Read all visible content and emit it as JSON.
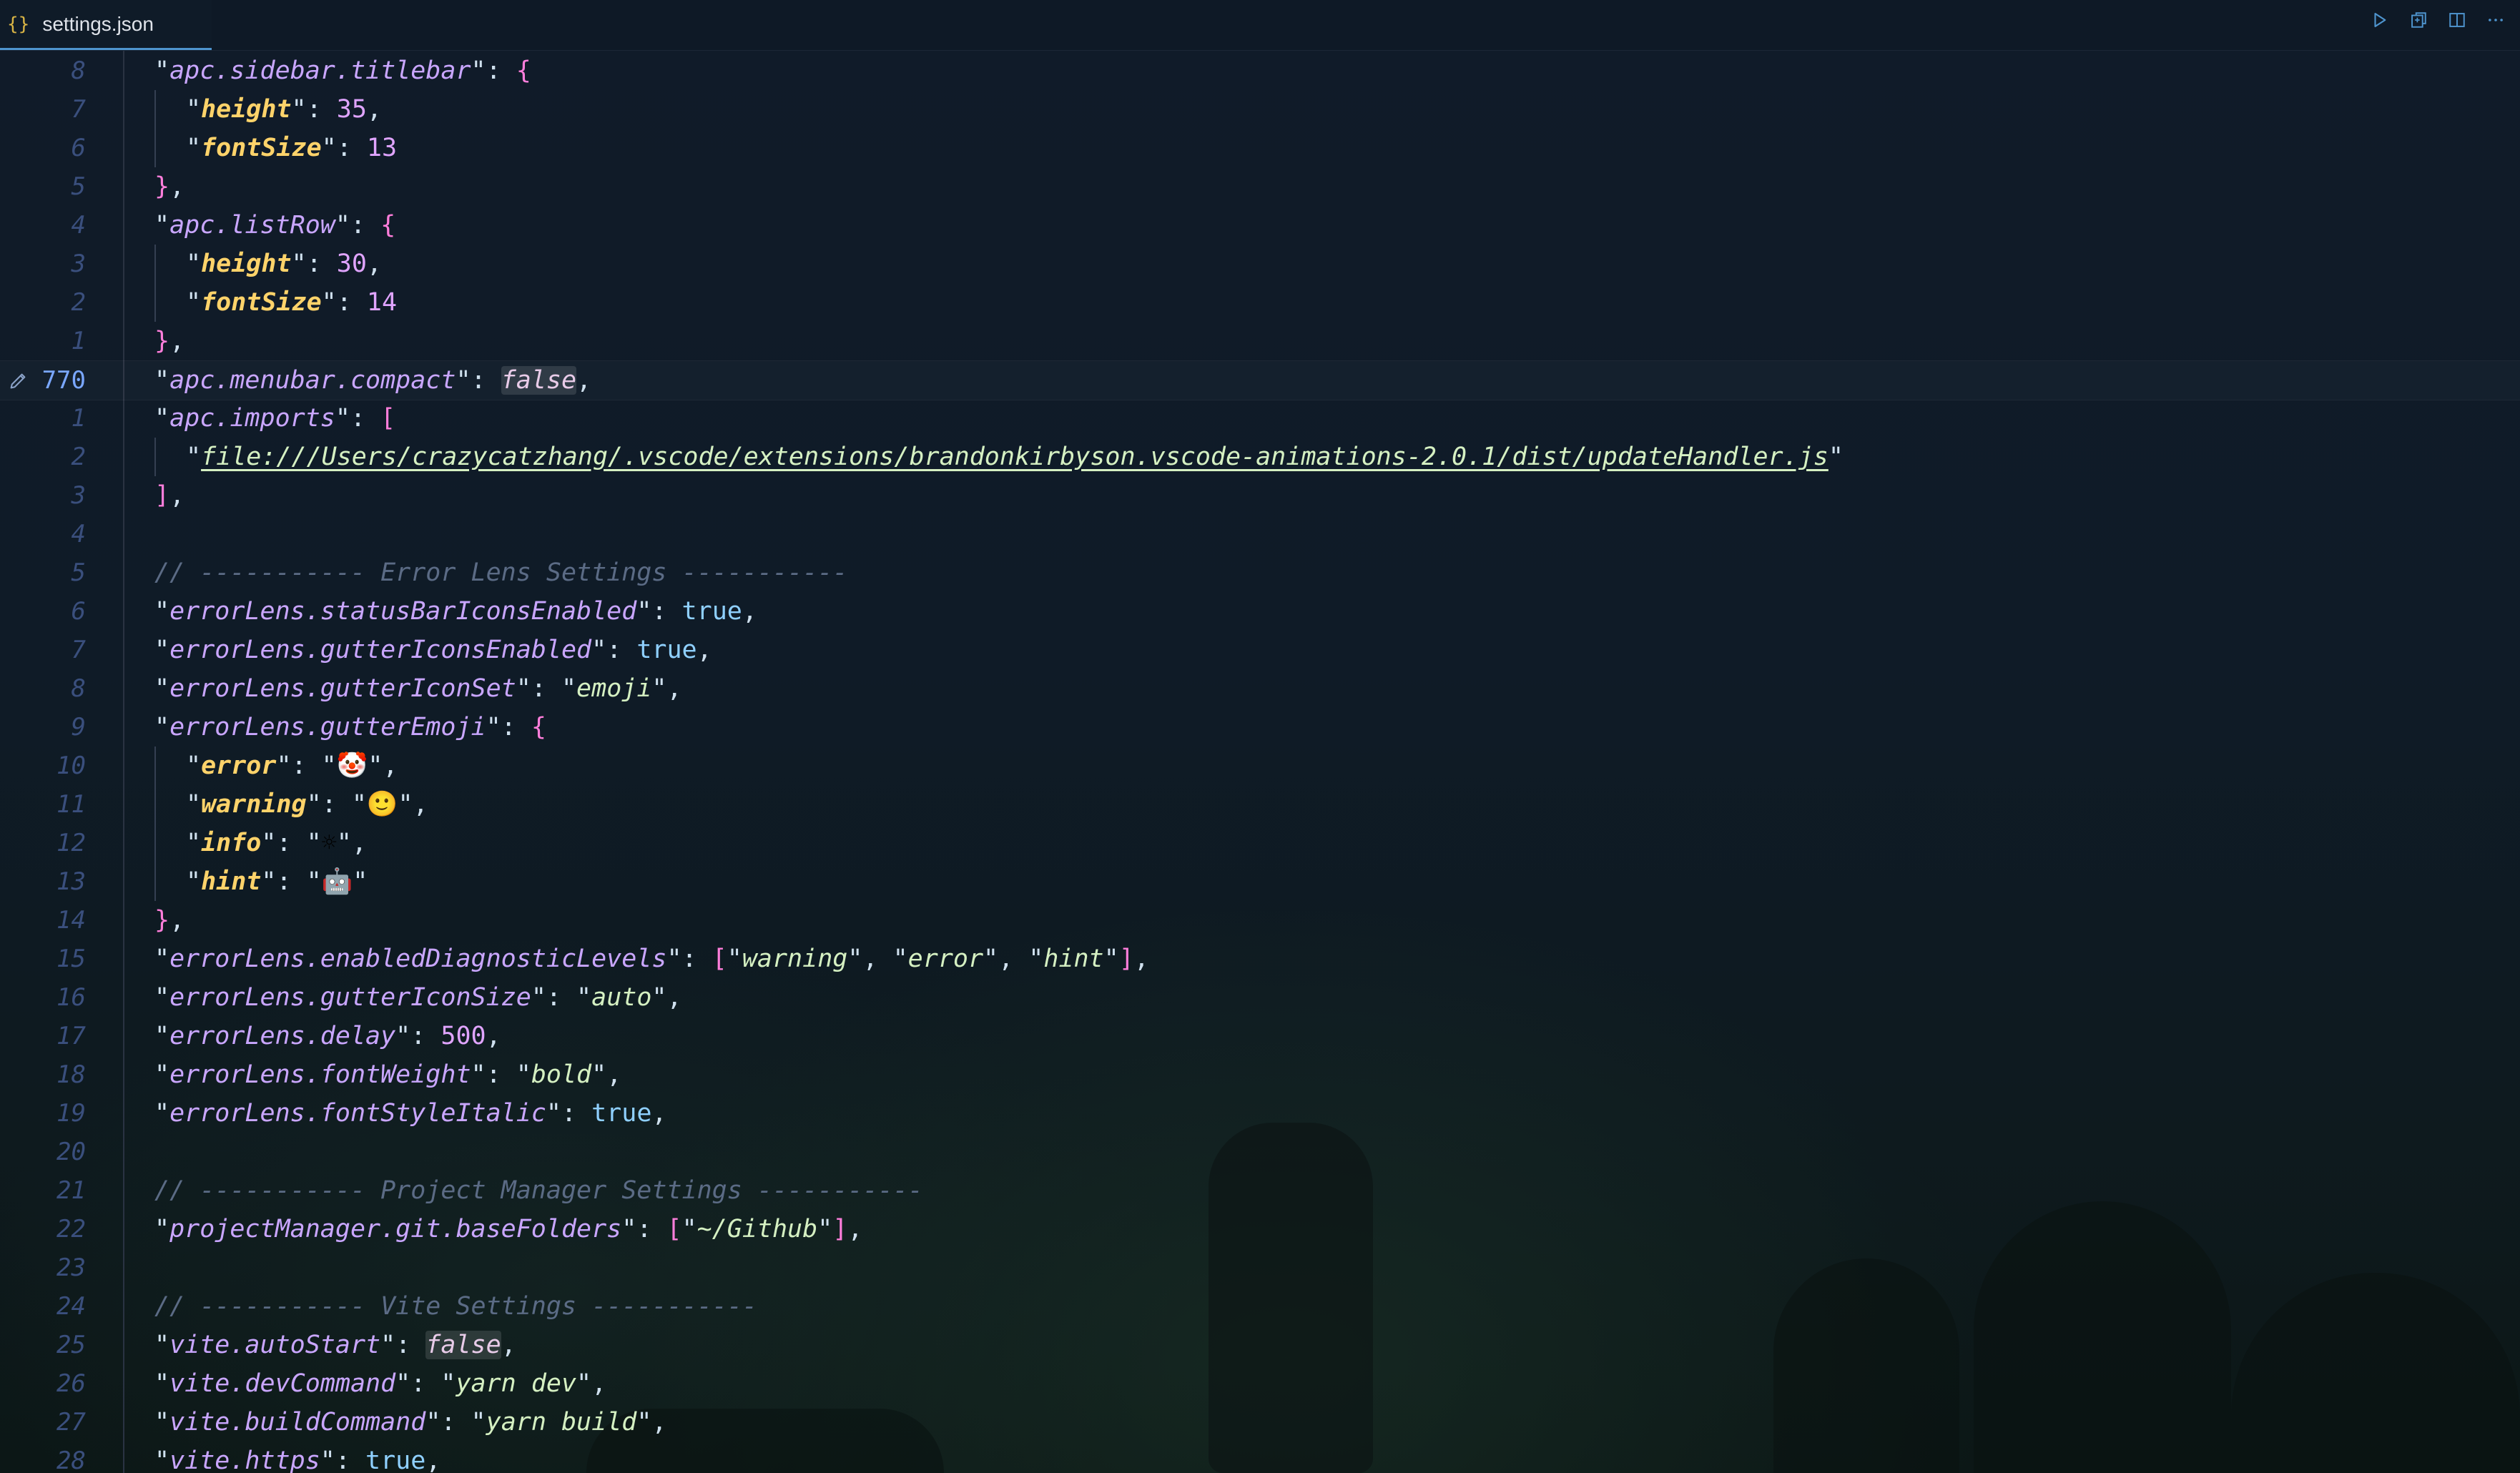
{
  "tab": {
    "icon": "{}",
    "label": "settings.json"
  },
  "actions": [
    {
      "name": "run-icon"
    },
    {
      "name": "open-changes-icon"
    },
    {
      "name": "split-editor-icon"
    },
    {
      "name": "more-actions-icon"
    }
  ],
  "editor": {
    "current_line": 770,
    "lines": [
      {
        "num": "8",
        "indent": 0,
        "tokens": [
          [
            "q",
            "\""
          ],
          [
            "k",
            "apc.sidebar.titlebar"
          ],
          [
            "q",
            "\""
          ],
          [
            "p",
            ": "
          ],
          [
            "b",
            "{"
          ]
        ]
      },
      {
        "num": "7",
        "indent": 1,
        "tokens": [
          [
            "q",
            "\""
          ],
          [
            "kk",
            "height"
          ],
          [
            "q",
            "\""
          ],
          [
            "p",
            ": "
          ],
          [
            "n",
            "35"
          ],
          [
            "p",
            ","
          ]
        ]
      },
      {
        "num": "6",
        "indent": 1,
        "tokens": [
          [
            "q",
            "\""
          ],
          [
            "kk",
            "fontSize"
          ],
          [
            "q",
            "\""
          ],
          [
            "p",
            ": "
          ],
          [
            "n",
            "13"
          ]
        ]
      },
      {
        "num": "5",
        "indent": 0,
        "tokens": [
          [
            "b",
            "}"
          ],
          [
            "p",
            ","
          ]
        ]
      },
      {
        "num": "4",
        "indent": 0,
        "tokens": [
          [
            "q",
            "\""
          ],
          [
            "k",
            "apc.listRow"
          ],
          [
            "q",
            "\""
          ],
          [
            "p",
            ": "
          ],
          [
            "b",
            "{"
          ]
        ]
      },
      {
        "num": "3",
        "indent": 1,
        "tokens": [
          [
            "q",
            "\""
          ],
          [
            "kk",
            "height"
          ],
          [
            "q",
            "\""
          ],
          [
            "p",
            ": "
          ],
          [
            "n",
            "30"
          ],
          [
            "p",
            ","
          ]
        ]
      },
      {
        "num": "2",
        "indent": 1,
        "tokens": [
          [
            "q",
            "\""
          ],
          [
            "kk",
            "fontSize"
          ],
          [
            "q",
            "\""
          ],
          [
            "p",
            ": "
          ],
          [
            "n",
            "14"
          ]
        ]
      },
      {
        "num": "1",
        "indent": 0,
        "tokens": [
          [
            "b",
            "}"
          ],
          [
            "p",
            ","
          ]
        ]
      },
      {
        "num": "770",
        "indent": 0,
        "current": true,
        "tokens": [
          [
            "q",
            "\""
          ],
          [
            "k",
            "apc.menubar.compact"
          ],
          [
            "q",
            "\""
          ],
          [
            "p",
            ": "
          ],
          [
            "f",
            "false"
          ],
          [
            "p",
            ","
          ]
        ]
      },
      {
        "num": "1",
        "indent": 0,
        "tokens": [
          [
            "q",
            "\""
          ],
          [
            "k",
            "apc.imports"
          ],
          [
            "q",
            "\""
          ],
          [
            "p",
            ": "
          ],
          [
            "b",
            "["
          ]
        ]
      },
      {
        "num": "2",
        "indent": 1,
        "tokens": [
          [
            "q",
            "\""
          ],
          [
            "u",
            "file:///Users/crazycatzhang/.vscode/extensions/brandonkirbyson.vscode-animations-2.0.1/dist/updateHandler.js"
          ],
          [
            "q",
            "\""
          ]
        ]
      },
      {
        "num": "3",
        "indent": 0,
        "tokens": [
          [
            "b",
            "]"
          ],
          [
            "p",
            ","
          ]
        ]
      },
      {
        "num": "4",
        "indent": 0,
        "tokens": []
      },
      {
        "num": "5",
        "indent": 0,
        "tokens": [
          [
            "c",
            "// ----------- Error Lens Settings -----------"
          ]
        ]
      },
      {
        "num": "6",
        "indent": 0,
        "tokens": [
          [
            "q",
            "\""
          ],
          [
            "k",
            "errorLens.statusBarIconsEnabled"
          ],
          [
            "q",
            "\""
          ],
          [
            "p",
            ": "
          ],
          [
            "t",
            "true"
          ],
          [
            "p",
            ","
          ]
        ]
      },
      {
        "num": "7",
        "indent": 0,
        "tokens": [
          [
            "q",
            "\""
          ],
          [
            "k",
            "errorLens.gutterIconsEnabled"
          ],
          [
            "q",
            "\""
          ],
          [
            "p",
            ": "
          ],
          [
            "t",
            "true"
          ],
          [
            "p",
            ","
          ]
        ]
      },
      {
        "num": "8",
        "indent": 0,
        "tokens": [
          [
            "q",
            "\""
          ],
          [
            "k",
            "errorLens.gutterIconSet"
          ],
          [
            "q",
            "\""
          ],
          [
            "p",
            ": "
          ],
          [
            "q",
            "\""
          ],
          [
            "s",
            "emoji"
          ],
          [
            "q",
            "\""
          ],
          [
            "p",
            ","
          ]
        ]
      },
      {
        "num": "9",
        "indent": 0,
        "tokens": [
          [
            "q",
            "\""
          ],
          [
            "k",
            "errorLens.gutterEmoji"
          ],
          [
            "q",
            "\""
          ],
          [
            "p",
            ": "
          ],
          [
            "b",
            "{"
          ]
        ]
      },
      {
        "num": "10",
        "indent": 1,
        "tokens": [
          [
            "q",
            "\""
          ],
          [
            "kk",
            "error"
          ],
          [
            "q",
            "\""
          ],
          [
            "p",
            ": "
          ],
          [
            "q",
            "\""
          ],
          [
            "emo",
            "🤡"
          ],
          [
            "q",
            "\""
          ],
          [
            "p",
            ","
          ]
        ]
      },
      {
        "num": "11",
        "indent": 1,
        "tokens": [
          [
            "q",
            "\""
          ],
          [
            "kk",
            "warning"
          ],
          [
            "q",
            "\""
          ],
          [
            "p",
            ": "
          ],
          [
            "q",
            "\""
          ],
          [
            "emo",
            "🙂"
          ],
          [
            "q",
            "\""
          ],
          [
            "p",
            ","
          ]
        ]
      },
      {
        "num": "12",
        "indent": 1,
        "tokens": [
          [
            "q",
            "\""
          ],
          [
            "kk",
            "info"
          ],
          [
            "q",
            "\""
          ],
          [
            "p",
            ": "
          ],
          [
            "q",
            "\""
          ],
          [
            "emo",
            "☼"
          ],
          [
            "q",
            "\""
          ],
          [
            "p",
            ","
          ]
        ]
      },
      {
        "num": "13",
        "indent": 1,
        "tokens": [
          [
            "q",
            "\""
          ],
          [
            "kk",
            "hint"
          ],
          [
            "q",
            "\""
          ],
          [
            "p",
            ": "
          ],
          [
            "q",
            "\""
          ],
          [
            "emo",
            "🤖"
          ],
          [
            "q",
            "\""
          ]
        ]
      },
      {
        "num": "14",
        "indent": 0,
        "tokens": [
          [
            "b",
            "}"
          ],
          [
            "p",
            ","
          ]
        ]
      },
      {
        "num": "15",
        "indent": 0,
        "tokens": [
          [
            "q",
            "\""
          ],
          [
            "k",
            "errorLens.enabledDiagnosticLevels"
          ],
          [
            "q",
            "\""
          ],
          [
            "p",
            ": "
          ],
          [
            "b",
            "["
          ],
          [
            "q",
            "\""
          ],
          [
            "s",
            "warning"
          ],
          [
            "q",
            "\""
          ],
          [
            "p",
            ", "
          ],
          [
            "q",
            "\""
          ],
          [
            "s",
            "error"
          ],
          [
            "q",
            "\""
          ],
          [
            "p",
            ", "
          ],
          [
            "q",
            "\""
          ],
          [
            "s",
            "hint"
          ],
          [
            "q",
            "\""
          ],
          [
            "b",
            "]"
          ],
          [
            "p",
            ","
          ]
        ]
      },
      {
        "num": "16",
        "indent": 0,
        "tokens": [
          [
            "q",
            "\""
          ],
          [
            "k",
            "errorLens.gutterIconSize"
          ],
          [
            "q",
            "\""
          ],
          [
            "p",
            ": "
          ],
          [
            "q",
            "\""
          ],
          [
            "s",
            "auto"
          ],
          [
            "q",
            "\""
          ],
          [
            "p",
            ","
          ]
        ]
      },
      {
        "num": "17",
        "indent": 0,
        "tokens": [
          [
            "q",
            "\""
          ],
          [
            "k",
            "errorLens.delay"
          ],
          [
            "q",
            "\""
          ],
          [
            "p",
            ": "
          ],
          [
            "n",
            "500"
          ],
          [
            "p",
            ","
          ]
        ]
      },
      {
        "num": "18",
        "indent": 0,
        "tokens": [
          [
            "q",
            "\""
          ],
          [
            "k",
            "errorLens.fontWeight"
          ],
          [
            "q",
            "\""
          ],
          [
            "p",
            ": "
          ],
          [
            "q",
            "\""
          ],
          [
            "s",
            "bold"
          ],
          [
            "q",
            "\""
          ],
          [
            "p",
            ","
          ]
        ]
      },
      {
        "num": "19",
        "indent": 0,
        "tokens": [
          [
            "q",
            "\""
          ],
          [
            "k",
            "errorLens.fontStyleItalic"
          ],
          [
            "q",
            "\""
          ],
          [
            "p",
            ": "
          ],
          [
            "t",
            "true"
          ],
          [
            "p",
            ","
          ]
        ]
      },
      {
        "num": "20",
        "indent": 0,
        "tokens": []
      },
      {
        "num": "21",
        "indent": 0,
        "tokens": [
          [
            "c",
            "// ----------- Project Manager Settings -----------"
          ]
        ]
      },
      {
        "num": "22",
        "indent": 0,
        "tokens": [
          [
            "q",
            "\""
          ],
          [
            "k",
            "projectManager.git.baseFolders"
          ],
          [
            "q",
            "\""
          ],
          [
            "p",
            ": "
          ],
          [
            "b",
            "["
          ],
          [
            "q",
            "\""
          ],
          [
            "s",
            "~/Github"
          ],
          [
            "q",
            "\""
          ],
          [
            "b",
            "]"
          ],
          [
            "p",
            ","
          ]
        ]
      },
      {
        "num": "23",
        "indent": 0,
        "tokens": []
      },
      {
        "num": "24",
        "indent": 0,
        "tokens": [
          [
            "c",
            "// ----------- Vite Settings -----------"
          ]
        ]
      },
      {
        "num": "25",
        "indent": 0,
        "tokens": [
          [
            "q",
            "\""
          ],
          [
            "k",
            "vite.autoStart"
          ],
          [
            "q",
            "\""
          ],
          [
            "p",
            ": "
          ],
          [
            "f",
            "false"
          ],
          [
            "p",
            ","
          ]
        ]
      },
      {
        "num": "26",
        "indent": 0,
        "tokens": [
          [
            "q",
            "\""
          ],
          [
            "k",
            "vite.devCommand"
          ],
          [
            "q",
            "\""
          ],
          [
            "p",
            ": "
          ],
          [
            "q",
            "\""
          ],
          [
            "s",
            "yarn dev"
          ],
          [
            "q",
            "\""
          ],
          [
            "p",
            ","
          ]
        ]
      },
      {
        "num": "27",
        "indent": 0,
        "tokens": [
          [
            "q",
            "\""
          ],
          [
            "k",
            "vite.buildCommand"
          ],
          [
            "q",
            "\""
          ],
          [
            "p",
            ": "
          ],
          [
            "q",
            "\""
          ],
          [
            "s",
            "yarn build"
          ],
          [
            "q",
            "\""
          ],
          [
            "p",
            ","
          ]
        ]
      },
      {
        "num": "28",
        "indent": 0,
        "tokens": [
          [
            "q",
            "\""
          ],
          [
            "k",
            "vite.https"
          ],
          [
            "q",
            "\""
          ],
          [
            "p",
            ": "
          ],
          [
            "t",
            "true"
          ],
          [
            "p",
            ","
          ]
        ]
      }
    ]
  }
}
